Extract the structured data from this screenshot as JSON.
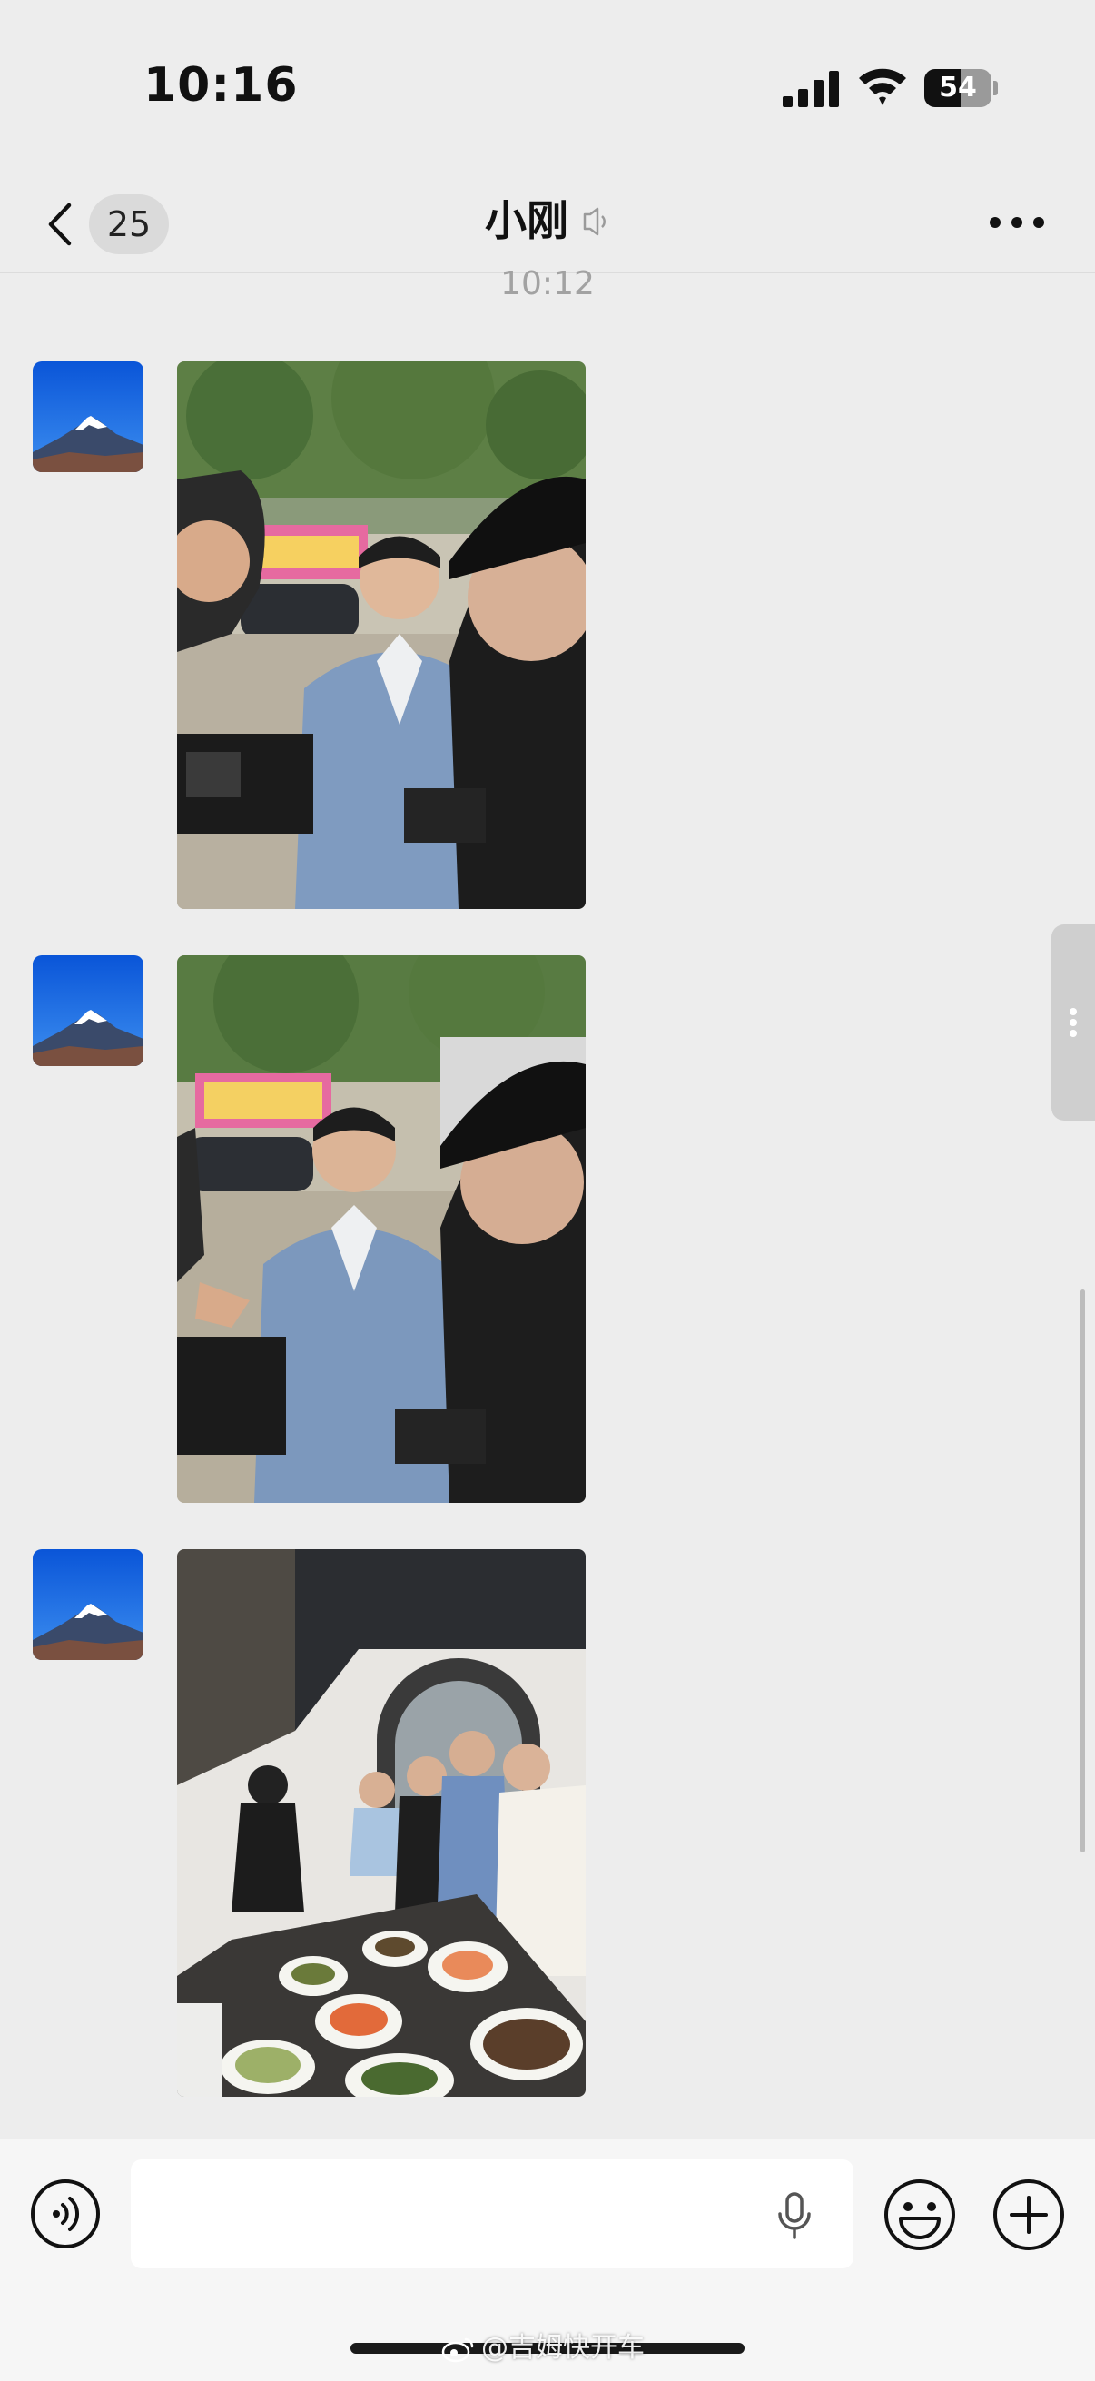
{
  "status_bar": {
    "time": "10:16",
    "battery_percent": 54,
    "battery_label": "54",
    "signal_icon": "cellular-signal-icon",
    "wifi_icon": "wifi-icon"
  },
  "nav": {
    "back_icon": "chevron-left-icon",
    "unread_count": "25",
    "title": "小刚",
    "mute_icon": "muted-bell-icon",
    "more_icon": "more-dots-icon"
  },
  "chat": {
    "timestamp": "10:12",
    "messages": [
      {
        "sender_avatar": "snow-mountain-avatar",
        "type": "image"
      },
      {
        "sender_avatar": "snow-mountain-avatar",
        "type": "image"
      },
      {
        "sender_avatar": "snow-mountain-avatar",
        "type": "image"
      }
    ]
  },
  "input_bar": {
    "voice_icon": "voice-mode-icon",
    "text_value": "",
    "mic_icon": "microphone-icon",
    "emoji_icon": "emoji-icon",
    "plus_icon": "plus-circle-icon"
  },
  "watermark": {
    "text": "@吉姆快开车",
    "logo_icon": "weibo-logo-icon"
  },
  "colors": {
    "background": "#ededed",
    "input_bar": "#f6f6f6",
    "timestamp": "#a2a2a2"
  }
}
